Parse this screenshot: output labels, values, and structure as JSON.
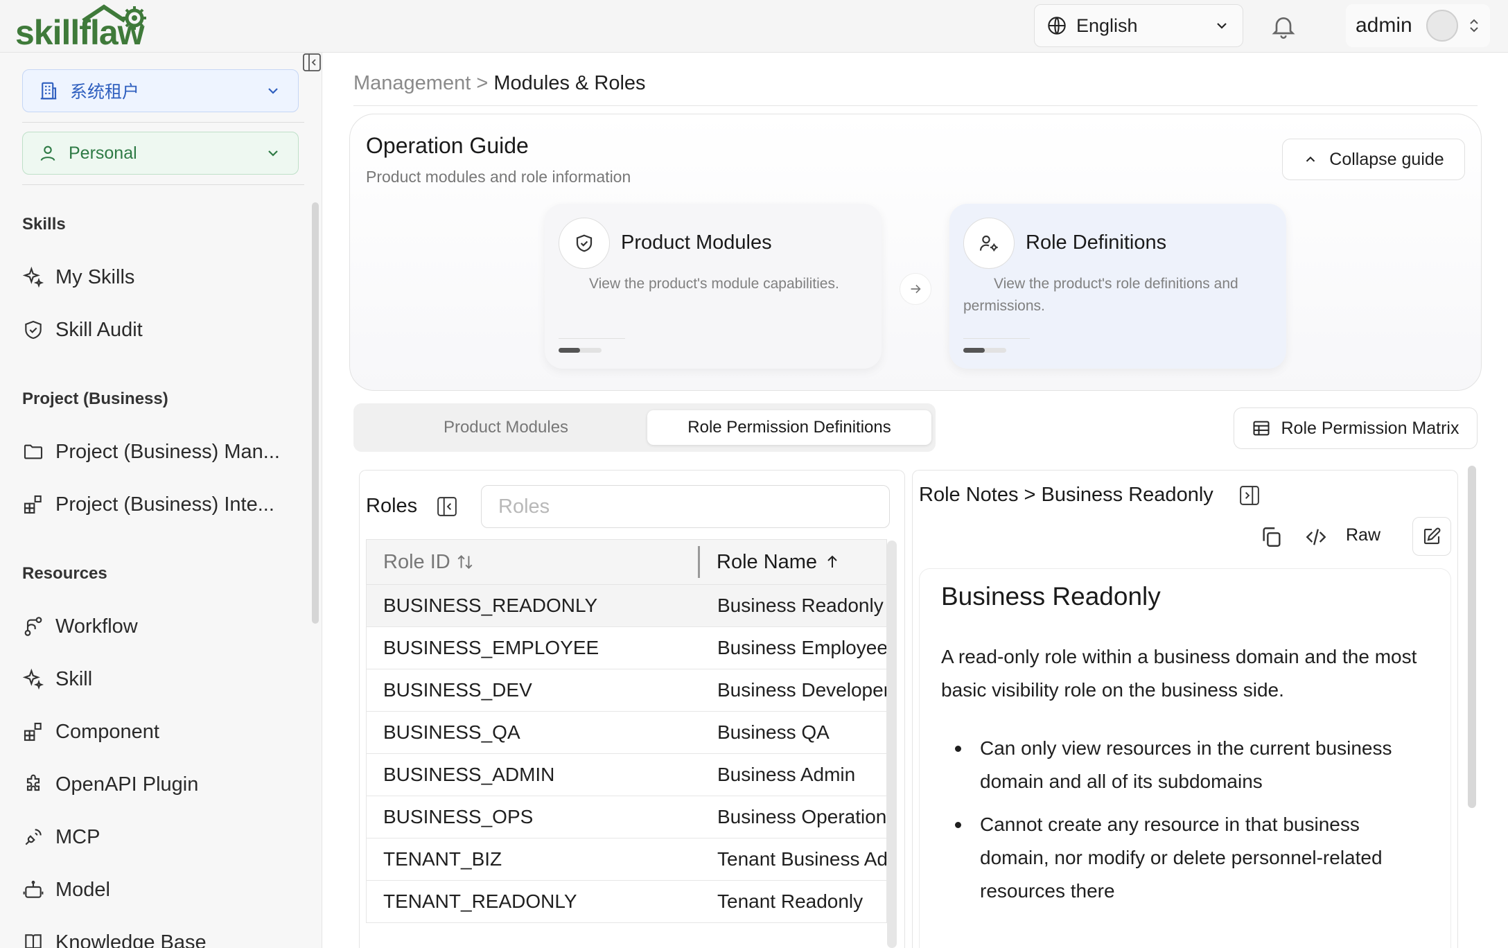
{
  "header": {
    "language": "English",
    "user_name": "admin"
  },
  "sidebar": {
    "tenant": "系统租户",
    "workspace": "Personal",
    "sections": [
      {
        "title": "Skills",
        "items": [
          {
            "label": "My Skills",
            "icon": "sparkle-icon"
          },
          {
            "label": "Skill Audit",
            "icon": "shield-check-icon"
          }
        ]
      },
      {
        "title": "Project (Business)",
        "items": [
          {
            "label": "Project (Business) Man...",
            "icon": "folder-icon"
          },
          {
            "label": "Project (Business) Inte...",
            "icon": "blocks-icon"
          }
        ]
      },
      {
        "title": "Resources",
        "items": [
          {
            "label": "Workflow",
            "icon": "workflow-icon"
          },
          {
            "label": "Skill",
            "icon": "sparkle-icon"
          },
          {
            "label": "Component",
            "icon": "blocks-icon"
          },
          {
            "label": "OpenAPI Plugin",
            "icon": "puzzle-icon"
          },
          {
            "label": "MCP",
            "icon": "plug-icon"
          },
          {
            "label": "Model",
            "icon": "robot-icon"
          },
          {
            "label": "Knowledge Base",
            "icon": "book-icon"
          }
        ]
      }
    ]
  },
  "breadcrumb": {
    "parent": "Management",
    "separator": " > ",
    "current": "Modules & Roles"
  },
  "guide": {
    "title": "Operation Guide",
    "subtitle": "Product modules and role information",
    "collapse_label": "Collapse guide",
    "cards": [
      {
        "title": "Product Modules",
        "desc": "View the product's module capabilities.",
        "progress": 0.5
      },
      {
        "title": "Role Definitions",
        "desc": "View the product's role definitions and permissions.",
        "progress": 0.5
      }
    ]
  },
  "tabs": {
    "modules": "Product Modules",
    "roles": "Role Permission Definitions",
    "active": "roles"
  },
  "matrix_button": "Role Permission Matrix",
  "roles": {
    "title": "Roles",
    "search_placeholder": "Roles",
    "columns": {
      "id": "Role ID",
      "name": "Role Name"
    },
    "rows": [
      {
        "id": "BUSINESS_READONLY",
        "name": "Business Readonly"
      },
      {
        "id": "BUSINESS_EMPLOYEE",
        "name": "Business Employee"
      },
      {
        "id": "BUSINESS_DEV",
        "name": "Business Developer"
      },
      {
        "id": "BUSINESS_QA",
        "name": "Business QA"
      },
      {
        "id": "BUSINESS_ADMIN",
        "name": "Business Admin"
      },
      {
        "id": "BUSINESS_OPS",
        "name": "Business Operations"
      },
      {
        "id": "TENANT_BIZ",
        "name": "Tenant Business Admin"
      },
      {
        "id": "TENANT_READONLY",
        "name": "Tenant Readonly"
      }
    ]
  },
  "notes": {
    "title": "Role Notes > Business Readonly",
    "raw_label": "Raw",
    "heading": "Business Readonly",
    "paragraph": "A read-only role within a business domain and the most basic visibility role on the business side.",
    "bullets": [
      "Can only view resources in the current business domain and all of its subdomains",
      "Cannot create any resource in that business domain, nor modify or delete personnel-related resources there"
    ]
  },
  "colors": {
    "logo_green": "#3f7a3a",
    "tenant_blue": "#2f5fbf",
    "personal_green": "#2e7a45"
  }
}
